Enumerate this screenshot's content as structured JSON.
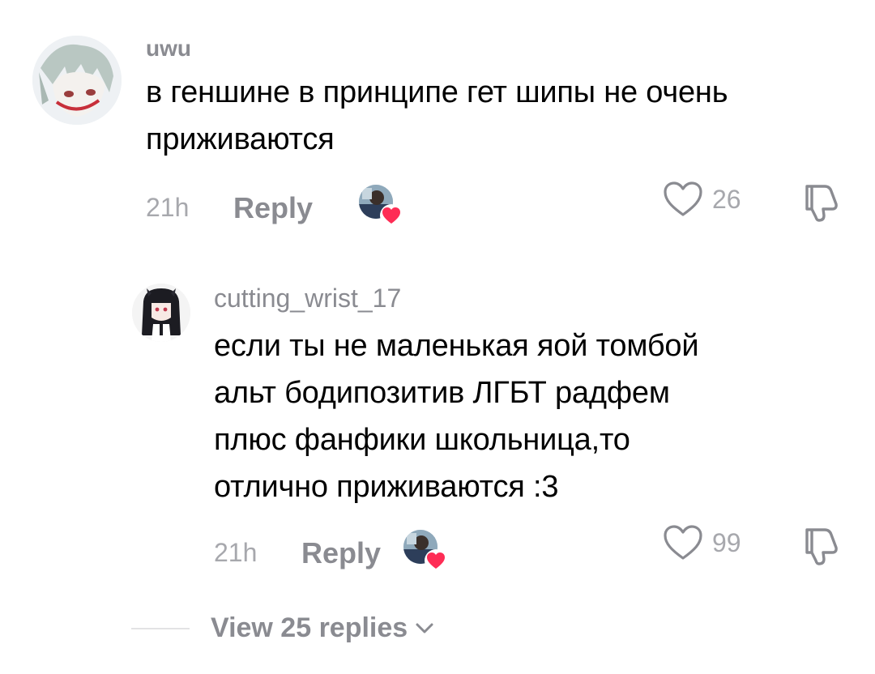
{
  "comments": [
    {
      "username": "uwu",
      "text_lines": [
        "в геншине в принципе гет шипы не очень",
        "приживаются"
      ],
      "time": "21h",
      "reply_label": "Reply",
      "likes": "26",
      "creator_liked": true
    },
    {
      "username": "cutting_wrist_17",
      "text_lines": [
        "если ты не маленькая яой томбой",
        "альт бодипозитив ЛГБТ радфем",
        "плюс фанфики школьница,то",
        "отлично приживаются :3"
      ],
      "time": "21h",
      "reply_label": "Reply",
      "likes": "99",
      "creator_liked": true
    }
  ],
  "view_replies": {
    "label": "View 25 replies"
  },
  "icons": {
    "like": "heart-outline-icon",
    "dislike": "thumbs-down-icon",
    "creator_like": "creator-heart-icon",
    "expand": "chevron-down-icon"
  },
  "colors": {
    "heart_red": "#fe2c55",
    "secondary_text": "#8a8b91",
    "tertiary_text": "#a7a8ad"
  }
}
